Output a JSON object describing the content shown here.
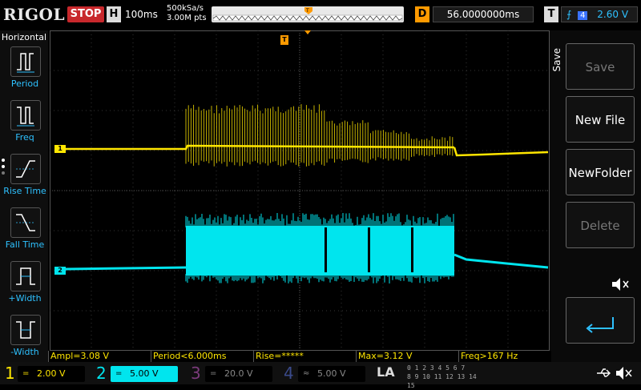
{
  "brand": "RIGOL",
  "run_state": "STOP",
  "horizontal": {
    "label": "H",
    "timebase": "100ms",
    "sample_rate": "500kSa/s",
    "memory": "3.00M pts"
  },
  "delay": {
    "label": "D",
    "value": "56.0000000ms"
  },
  "trigger": {
    "label": "T",
    "source": "4",
    "level": "2.60 V"
  },
  "left_menu": {
    "title": "Horizontal",
    "items": [
      {
        "label": "Period",
        "icon": "period-icon"
      },
      {
        "label": "Freq",
        "icon": "freq-icon"
      },
      {
        "label": "Rise Time",
        "icon": "rise-time-icon"
      },
      {
        "label": "Fall Time",
        "icon": "fall-time-icon"
      },
      {
        "label": "+Width",
        "icon": "positive-width-icon"
      },
      {
        "label": "-Width",
        "icon": "negative-width-icon"
      }
    ]
  },
  "right_menu": {
    "tab": "Save",
    "buttons": [
      {
        "label": "Save",
        "enabled": false
      },
      {
        "label": "New File",
        "enabled": true
      },
      {
        "label": "NewFolder",
        "enabled": true
      },
      {
        "label": "Delete",
        "enabled": false
      }
    ]
  },
  "measurements": [
    {
      "text": "Ampl=3.08 V"
    },
    {
      "text": "Period<6.000ms"
    },
    {
      "text": "Rise=*****"
    },
    {
      "text": "Max=3.12 V"
    },
    {
      "text": "Freq>167 Hz"
    }
  ],
  "channels": [
    {
      "num": "1",
      "coupling": "=",
      "scale": "2.00 V",
      "color": "#ffe600",
      "active": true
    },
    {
      "num": "2",
      "coupling": "=",
      "scale": "5.00 V",
      "color": "#00e5ee",
      "active": true
    },
    {
      "num": "3",
      "coupling": "=",
      "scale": "20.0 V",
      "color": "#c04ec0",
      "active": false
    },
    {
      "num": "4",
      "coupling": "≈",
      "scale": "5.00 V",
      "color": "#3a72ff",
      "active": false
    }
  ],
  "trace_markers": {
    "ch1": "1",
    "ch2": "2",
    "trigger_level": "T",
    "trigger_pos": "T"
  },
  "logic_analyzer": {
    "label": "LA",
    "bits_row1": "0 1 2 3  4 5 6 7",
    "bits_row2": "8 9 10 11  12 13 14 15"
  },
  "colors": {
    "ch1": "#ffe600",
    "ch2": "#00e5ee",
    "trigger": "#ff9a00",
    "menu_accent": "#2ec1ff"
  }
}
